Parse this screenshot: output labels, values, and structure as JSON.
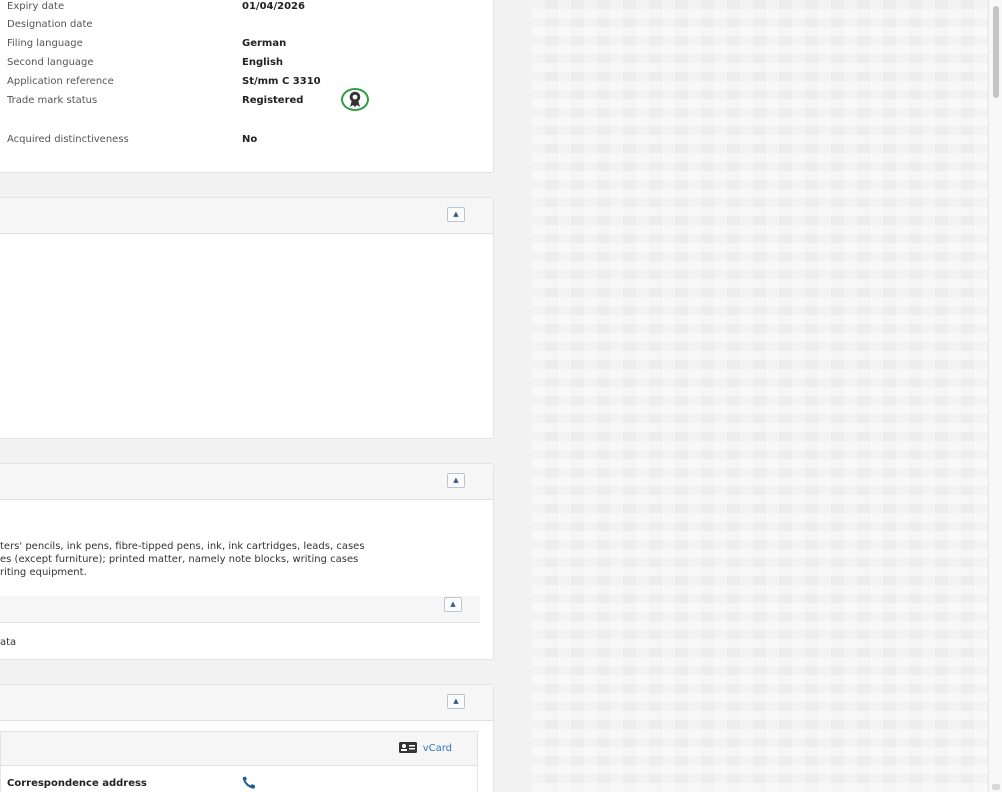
{
  "details": {
    "rows": [
      {
        "label": "Expiry date",
        "value": "01/04/2026"
      },
      {
        "label": "Designation date",
        "value": ""
      },
      {
        "label": "Filing language",
        "value": "German"
      },
      {
        "label": "Second language",
        "value": "English"
      },
      {
        "label": "Application reference",
        "value": "St/mm C 3310"
      },
      {
        "label": "Trade mark status",
        "value": "Registered"
      },
      {
        "label": "Acquired distinctiveness",
        "value": "No"
      }
    ],
    "status_icon": "registered-award-icon",
    "status_color": "#2e9c3f"
  },
  "goods": {
    "lines": [
      "ters' pencils, ink pens, fibre-tipped pens, ink, ink cartridges, leads, cases",
      "es (except furniture); printed matter, namely note blocks, writing cases",
      "riting equipment."
    ],
    "no_data": "ata"
  },
  "representative": {
    "vcard_label": "vCard",
    "correspondence_label": "Correspondence address"
  },
  "colors": {
    "accent": "#2f78b7",
    "header_bg": "#f6f6f6",
    "badge_ring": "#2e9c3f"
  }
}
